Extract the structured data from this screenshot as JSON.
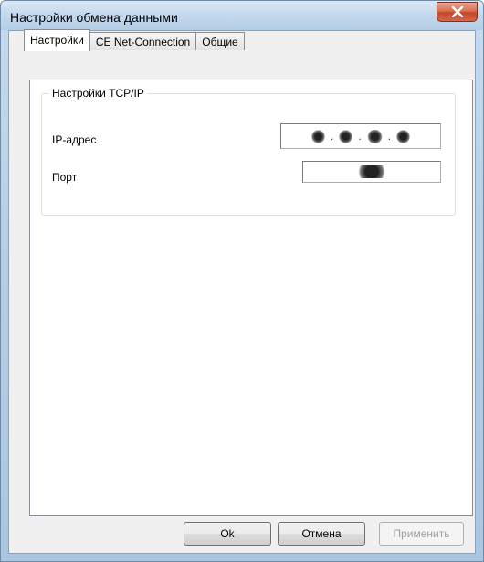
{
  "window": {
    "title": "Настройки обмена данными"
  },
  "tabs": [
    {
      "label": "Настройки",
      "active": true
    },
    {
      "label": "CE Net-Connection",
      "active": false
    },
    {
      "label": "Общие",
      "active": false
    }
  ],
  "group": {
    "legend": "Настройки TCP/IP",
    "ip_label": "IP-адрес",
    "port_label": "Порт",
    "ip_separators": [
      ".",
      ".",
      "."
    ]
  },
  "buttons": {
    "ok": "Ok",
    "cancel": "Отмена",
    "apply": "Применить"
  },
  "icons": {
    "close": "close-icon"
  },
  "colors": {
    "close_button": "#c4452b",
    "titlebar": "#c5d9ee"
  }
}
